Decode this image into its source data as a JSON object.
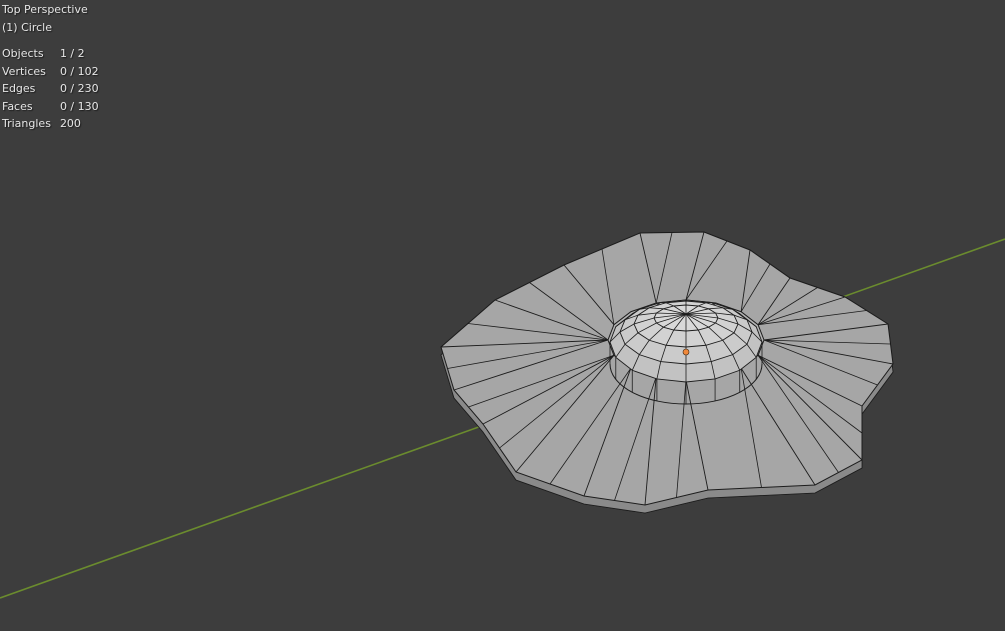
{
  "viewport": {
    "view_name": "Top Perspective",
    "active_object": "(1) Circle"
  },
  "stats": [
    {
      "label": "Objects",
      "value": "1 / 2"
    },
    {
      "label": "Vertices",
      "value": "0 / 102"
    },
    {
      "label": "Edges",
      "value": "0 / 230"
    },
    {
      "label": "Faces",
      "value": "0 / 130"
    },
    {
      "label": "Triangles",
      "value": "200"
    }
  ],
  "colors": {
    "background": "#3d3d3d",
    "axis_x": "#6b8c2e",
    "mesh_face": "#a6a6a6",
    "mesh_edge": "#1c1c1c",
    "origin": "#f0883a"
  }
}
